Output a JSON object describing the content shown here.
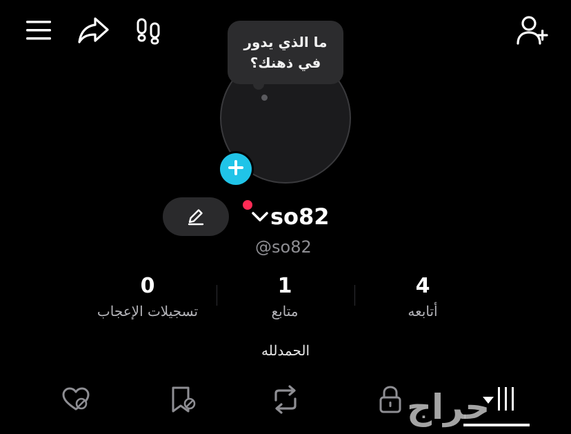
{
  "profile": {
    "thought_bubble": {
      "line1": "ما الذي يدور",
      "line2": "في ذهنك؟"
    },
    "username": "so82",
    "handle": "@so82",
    "bio": "الحمدلله"
  },
  "stats": [
    {
      "value": "0",
      "label": "تسجيلات الإعجاب"
    },
    {
      "value": "1",
      "label": "متابع"
    },
    {
      "value": "4",
      "label": "أتابعه"
    }
  ],
  "watermark": "حراج",
  "icons": {
    "top_left": [
      "menu-icon",
      "share-icon",
      "footprints-icon"
    ],
    "top_right": "add-user-icon",
    "tabs": [
      "liked-hidden-icon",
      "favorites-hidden-icon",
      "repost-icon",
      "lock-icon",
      "grid-icon"
    ]
  },
  "colors": {
    "background": "#000000",
    "accent": "#20c4e8",
    "notification": "#ff2b55",
    "secondary_text": "#8e8e93"
  }
}
